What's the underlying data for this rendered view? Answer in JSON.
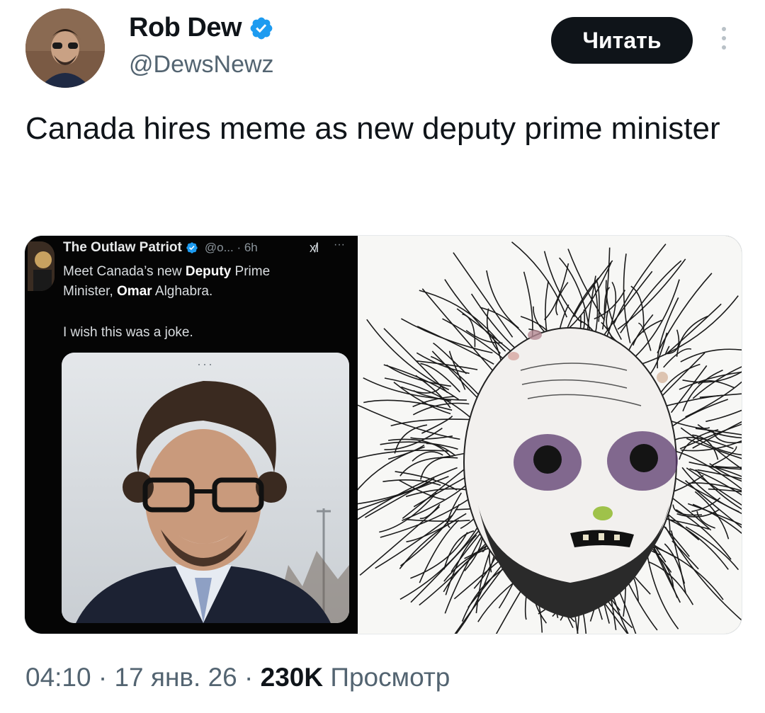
{
  "author": {
    "name": "Rob Dew",
    "handle": "@DewsNewz",
    "verified": true
  },
  "follow_button": {
    "label": "Читать"
  },
  "more_icon": "vertical-dots-icon",
  "tweet": {
    "text": "Canada hires meme as new deputy prime minister"
  },
  "embedded_post": {
    "author_name": "The Outlaw Patriot",
    "meta": "@o... · 6h",
    "x_logo": "x̸l",
    "more": "···",
    "line1_pre": "Meet Canada’s new ",
    "line1_bold": "Deputy",
    "line1_post": " Prime",
    "line2_pre": "Minister, ",
    "line2_bold": "Omar",
    "line2_post": " Alghabra.",
    "line3": "I wish this was a joke.",
    "photo_dots": "···"
  },
  "footer": {
    "time": "04:10",
    "sep1": " · ",
    "date": "17 янв. 26",
    "sep2": " · ",
    "views": "230K",
    "views_label": " Просмотр"
  },
  "colors": {
    "text": "#0f1419",
    "secondary": "#536471",
    "verified_blue": "#1d9bf0",
    "button_bg": "#0f1419"
  }
}
